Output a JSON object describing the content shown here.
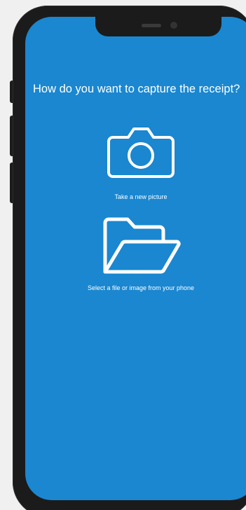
{
  "screen": {
    "background": "#1a87d0",
    "question": "How do you want to capture the receipt?"
  },
  "options": [
    {
      "icon": "camera-icon",
      "label": "Take a new picture"
    },
    {
      "icon": "folder-open-icon",
      "label": "Select a file or image from your phone"
    }
  ]
}
